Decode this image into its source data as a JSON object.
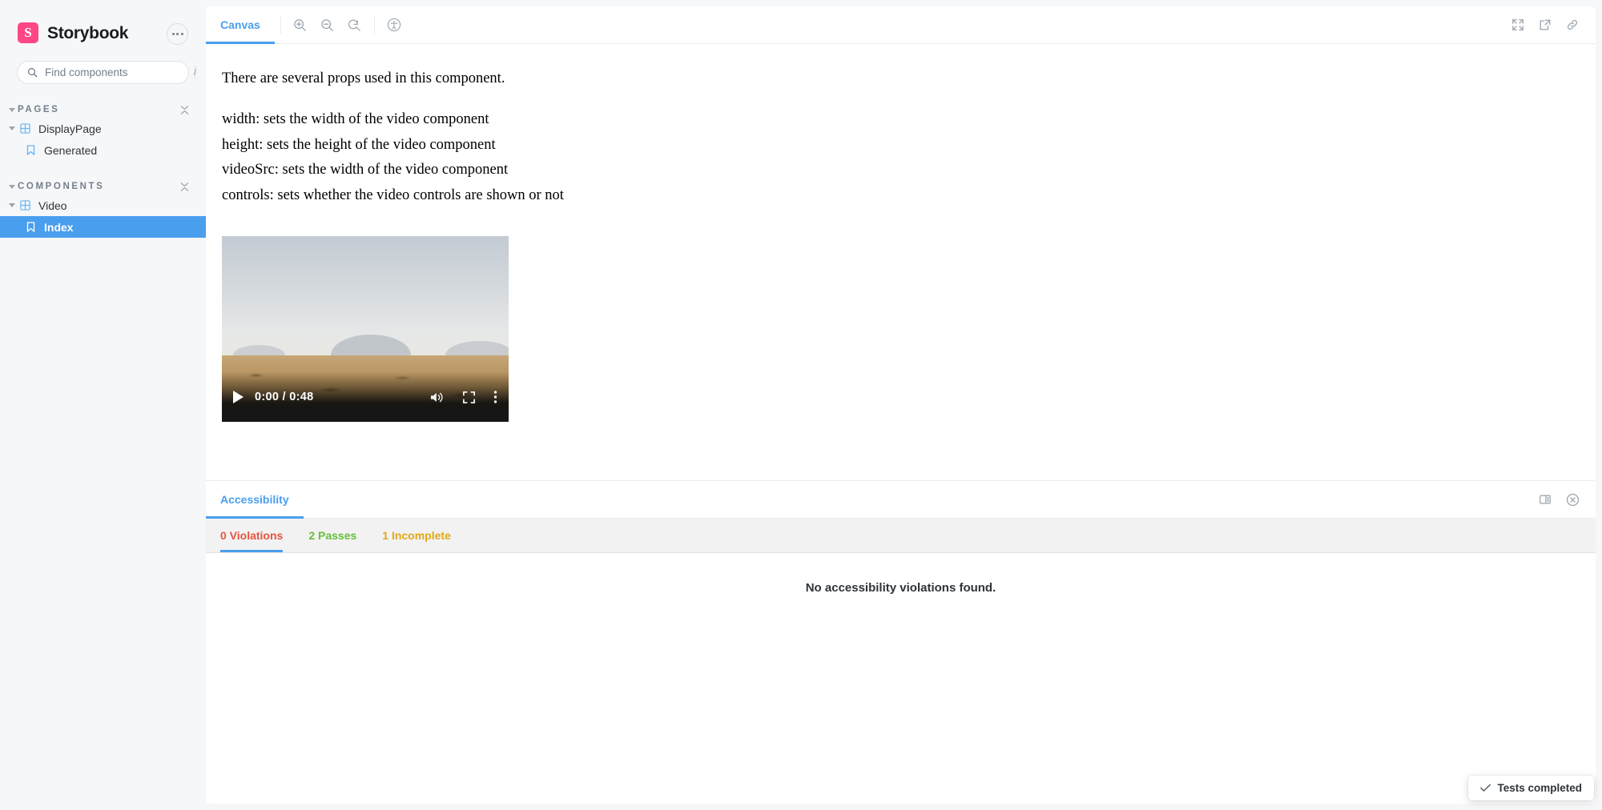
{
  "sidebar": {
    "brand_name": "Storybook",
    "logo_letter": "S",
    "logo_color": "#ff4785",
    "menu_icon": "ellipsis-icon",
    "search": {
      "placeholder": "Find components",
      "value": "",
      "shortcut": "/",
      "icon": "search-icon"
    },
    "sections": [
      {
        "title": "PAGES",
        "collapse_icon": "collapse-all-icon",
        "items": [
          {
            "label": "DisplayPage",
            "icon": "component-grid-icon",
            "depth": 1,
            "selected": false,
            "expanded": true
          },
          {
            "label": "Generated",
            "icon": "story-bookmark-icon",
            "depth": 2,
            "selected": false
          }
        ]
      },
      {
        "title": "COMPONENTS",
        "collapse_icon": "collapse-all-icon",
        "items": [
          {
            "label": "Video",
            "icon": "component-grid-icon",
            "depth": 1,
            "selected": false,
            "expanded": true
          },
          {
            "label": "Index",
            "icon": "story-bookmark-icon",
            "depth": 2,
            "selected": true
          }
        ]
      }
    ]
  },
  "toolbar": {
    "tab_label": "Canvas",
    "zoom_in_icon": "zoom-in-icon",
    "zoom_out_icon": "zoom-out-icon",
    "zoom_reset_icon": "zoom-reset-icon",
    "a11y_icon": "accessibility-icon",
    "fullscreen_icon": "expand-fullscreen-icon",
    "open_new_tab_icon": "open-in-new-tab-icon",
    "copy_link_icon": "copy-link-icon"
  },
  "canvas": {
    "intro": "There are several props used in this component.",
    "props": [
      "width: sets the width of the video component",
      "height: sets the height of the video component",
      "videoSrc: sets the width of the video component",
      "controls: sets whether the video controls are shown or not"
    ],
    "video": {
      "current_time": "0:00",
      "duration": "0:48",
      "time_display": "0:00 / 0:48",
      "progress_percent": 4,
      "play_icon": "play-icon",
      "volume_icon": "volume-on-icon",
      "fullscreen_icon": "video-fullscreen-icon",
      "more_icon": "more-vertical-icon"
    }
  },
  "addon_panel": {
    "tab_label": "Accessibility",
    "layout_icon": "panel-position-icon",
    "close_icon": "close-circle-icon",
    "subtabs": [
      {
        "label": "0 Violations",
        "color": "#e8543f",
        "active": true
      },
      {
        "label": "2 Passes",
        "color": "#66bf3c",
        "active": false
      },
      {
        "label": "1 Incomplete",
        "color": "#e1a817",
        "active": false
      }
    ],
    "empty_message": "No accessibility violations found."
  },
  "toast": {
    "label": "Tests completed",
    "icon": "check-icon"
  }
}
